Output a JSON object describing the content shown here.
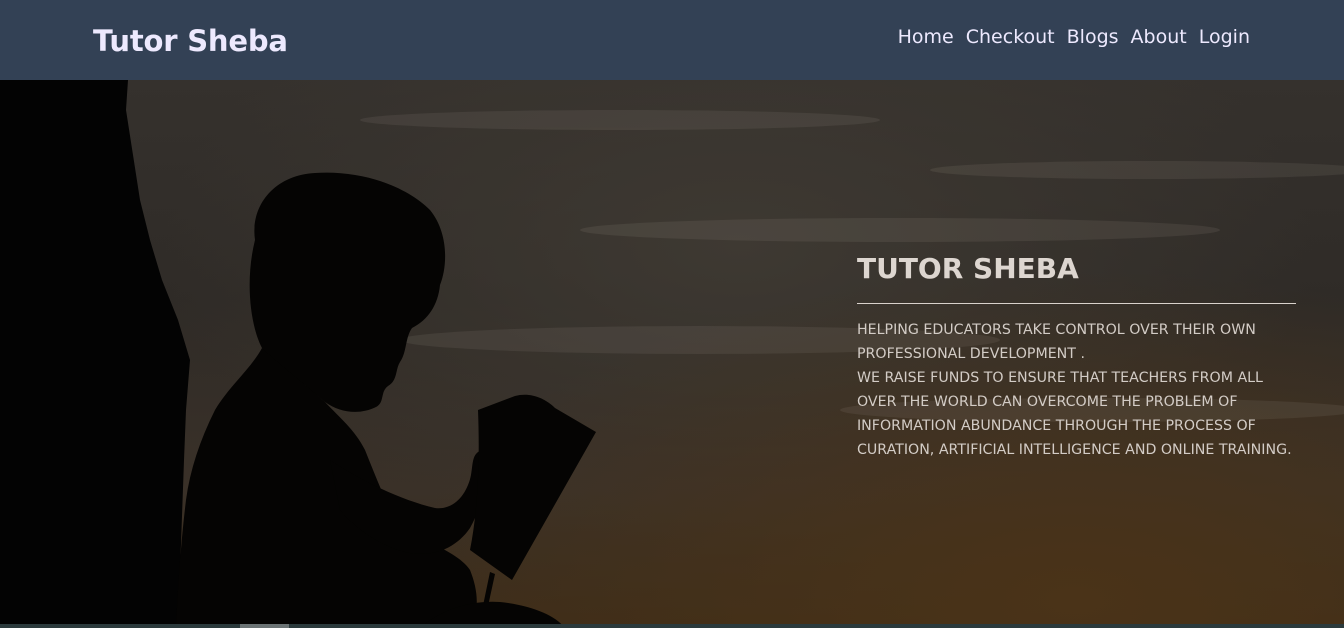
{
  "navbar": {
    "brand": "Tutor Sheba",
    "links": [
      "Home",
      "Checkout",
      "Blogs",
      "About",
      "Login"
    ]
  },
  "hero": {
    "title": "TUTOR SHEBA",
    "paragraph_1": "HELPING EDUCATORS TAKE CONTROL OVER THEIR OWN PROFESSIONAL DEVELOPMENT .",
    "paragraph_2": "WE RAISE FUNDS TO ENSURE THAT TEACHERS FROM ALL OVER THE WORLD CAN OVERCOME THE PROBLEM OF INFORMATION ABUNDANCE THROUGH THE PROCESS OF CURATION, ARTIFICIAL INTELLIGENCE AND ONLINE TRAINING.",
    "image_subject": "silhouette of child reading a book at dusk"
  },
  "colors": {
    "navbar_bg": "#334155",
    "nav_text": "#ede9fe",
    "hero_text": "#ddd6d0"
  }
}
